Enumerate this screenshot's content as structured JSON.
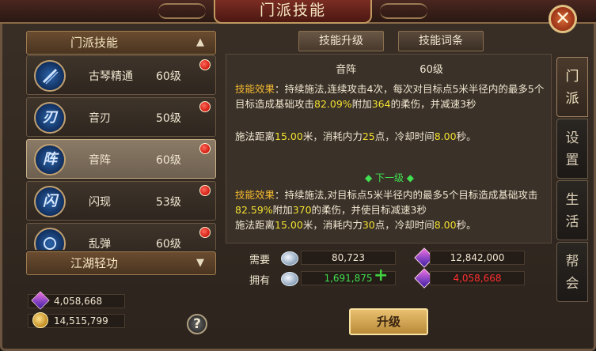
{
  "window": {
    "title": "门派技能",
    "close_label": "✕"
  },
  "left": {
    "section1_label": "门派技能",
    "section1_arrow": "▲",
    "section2_label": "江湖轻功",
    "section2_arrow": "▼",
    "skills": [
      {
        "name": "古琴精通",
        "level": "60级",
        "icon_char": "",
        "icon_name": "guqin-icon",
        "has_red_dot": true
      },
      {
        "name": "音刃",
        "level": "50级",
        "icon_char": "刃",
        "icon_name": "blade-icon",
        "has_red_dot": true
      },
      {
        "name": "音阵",
        "level": "60级",
        "icon_char": "阵",
        "icon_name": "formation-icon",
        "has_red_dot": true
      },
      {
        "name": "闪现",
        "level": "53级",
        "icon_char": "闪",
        "icon_name": "flash-icon",
        "has_red_dot": true
      },
      {
        "name": "乱弹",
        "level": "60级",
        "icon_char": "",
        "icon_name": "scatter-icon",
        "has_red_dot": true
      }
    ],
    "currency": {
      "gems": "4,058,668",
      "coins": "14,515,799"
    },
    "help_label": "?"
  },
  "tabs": {
    "upgrade": "技能升级",
    "affix": "技能词条"
  },
  "detail": {
    "skill_name": "音阵",
    "skill_level": "60级",
    "effect_label": "技能效果",
    "current": {
      "part1": "：持续施法,连续攻击4次，每次对目标点5米半径内的最多5个目标造成基础攻击",
      "pct": "82.09%",
      "part2": "附加",
      "dmg": "364",
      "part3": "的柔伤，并减速3秒"
    },
    "cast1": {
      "a": "施法距离",
      "dist": "15.00",
      "b": "米，消耗内力",
      "cost": "25",
      "c": "点，冷却时间",
      "cd": "8.00",
      "d": "秒。"
    },
    "next_level_label": "◆ 下一级 ◆",
    "next": {
      "part1": "：持续施法,对目标点5米半径内的最多5个目标造成基础攻击",
      "pct": "82.59%",
      "part2": "附加",
      "dmg": "370",
      "part3": "的柔伤，并使目标减速3秒"
    },
    "cast2": {
      "a": "施法距离",
      "dist": "15.00",
      "b": "米，消耗内力",
      "cost": "30",
      "c": "点，冷却时间",
      "cd": "8.00",
      "d": "秒。"
    }
  },
  "resources": {
    "need_label": "需要",
    "own_label": "拥有",
    "need_silver": "80,723",
    "need_gem": "12,842,000",
    "own_silver": "1,691,875",
    "own_gem": "4,058,668",
    "own_silver_color": "#40e050",
    "own_gem_color": "#ff3030",
    "plus": "+"
  },
  "upgrade_label": "升级",
  "side_tabs": [
    {
      "label_lines": [
        "门",
        "派"
      ],
      "active": true
    },
    {
      "label_lines": [
        "设",
        "置"
      ],
      "active": false
    },
    {
      "label_lines": [
        "生",
        "活"
      ],
      "active": false
    },
    {
      "label_lines": [
        "帮",
        "会"
      ],
      "active": false
    }
  ]
}
